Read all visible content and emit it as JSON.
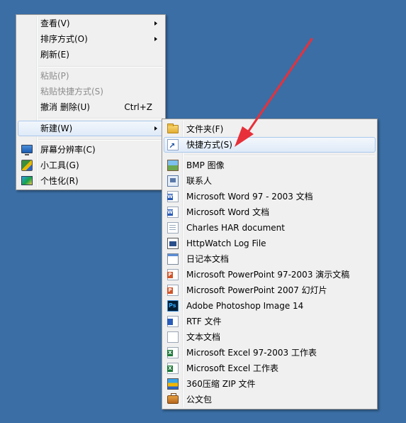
{
  "context_menu": {
    "items": [
      {
        "label": "查看(V)",
        "has_submenu": true
      },
      {
        "label": "排序方式(O)",
        "has_submenu": true
      },
      {
        "label": "刷新(E)"
      },
      {
        "label": "粘贴(P)",
        "disabled": true
      },
      {
        "label": "粘贴快捷方式(S)",
        "disabled": true
      },
      {
        "label": "撤消 删除(U)",
        "shortcut": "Ctrl+Z"
      },
      {
        "label": "新建(W)",
        "has_submenu": true,
        "highlighted": true
      },
      {
        "label": "屏幕分辨率(C)",
        "icon": "display-icon"
      },
      {
        "label": "小工具(G)",
        "icon": "gadgets-icon"
      },
      {
        "label": "个性化(R)",
        "icon": "personalize-icon"
      }
    ]
  },
  "new_submenu": {
    "items": [
      {
        "label": "文件夹(F)",
        "icon": "folder-icon"
      },
      {
        "label": "快捷方式(S)",
        "icon": "shortcut-icon",
        "highlighted": true
      },
      {
        "label": "BMP 图像",
        "icon": "bitmap-icon"
      },
      {
        "label": "联系人",
        "icon": "contact-icon"
      },
      {
        "label": "Microsoft Word 97 - 2003 文档",
        "icon": "word-icon"
      },
      {
        "label": "Microsoft Word 文档",
        "icon": "word-icon"
      },
      {
        "label": "Charles HAR document",
        "icon": "document-icon"
      },
      {
        "label": "HttpWatch Log File",
        "icon": "log-file-icon"
      },
      {
        "label": "日记本文档",
        "icon": "journal-icon"
      },
      {
        "label": "Microsoft PowerPoint 97-2003 演示文稿",
        "icon": "powerpoint-icon"
      },
      {
        "label": "Microsoft PowerPoint 2007 幻灯片",
        "icon": "powerpoint-icon"
      },
      {
        "label": "Adobe Photoshop Image 14",
        "icon": "photoshop-icon"
      },
      {
        "label": "RTF 文件",
        "icon": "rtf-icon"
      },
      {
        "label": "文本文档",
        "icon": "text-file-icon"
      },
      {
        "label": "Microsoft Excel 97-2003 工作表",
        "icon": "excel-icon"
      },
      {
        "label": "Microsoft Excel 工作表",
        "icon": "excel-icon"
      },
      {
        "label": "360压缩 ZIP 文件",
        "icon": "zip-icon"
      },
      {
        "label": "公文包",
        "icon": "briefcase-icon"
      }
    ]
  },
  "annotation": {
    "type": "arrow",
    "color": "#e8303a",
    "target": "shortcut-item"
  },
  "colors": {
    "desktop": "#3a6ea5",
    "menu_bg": "#f0f0f0",
    "highlight_border": "#aac8ec",
    "disabled_text": "#8d8d8d"
  }
}
